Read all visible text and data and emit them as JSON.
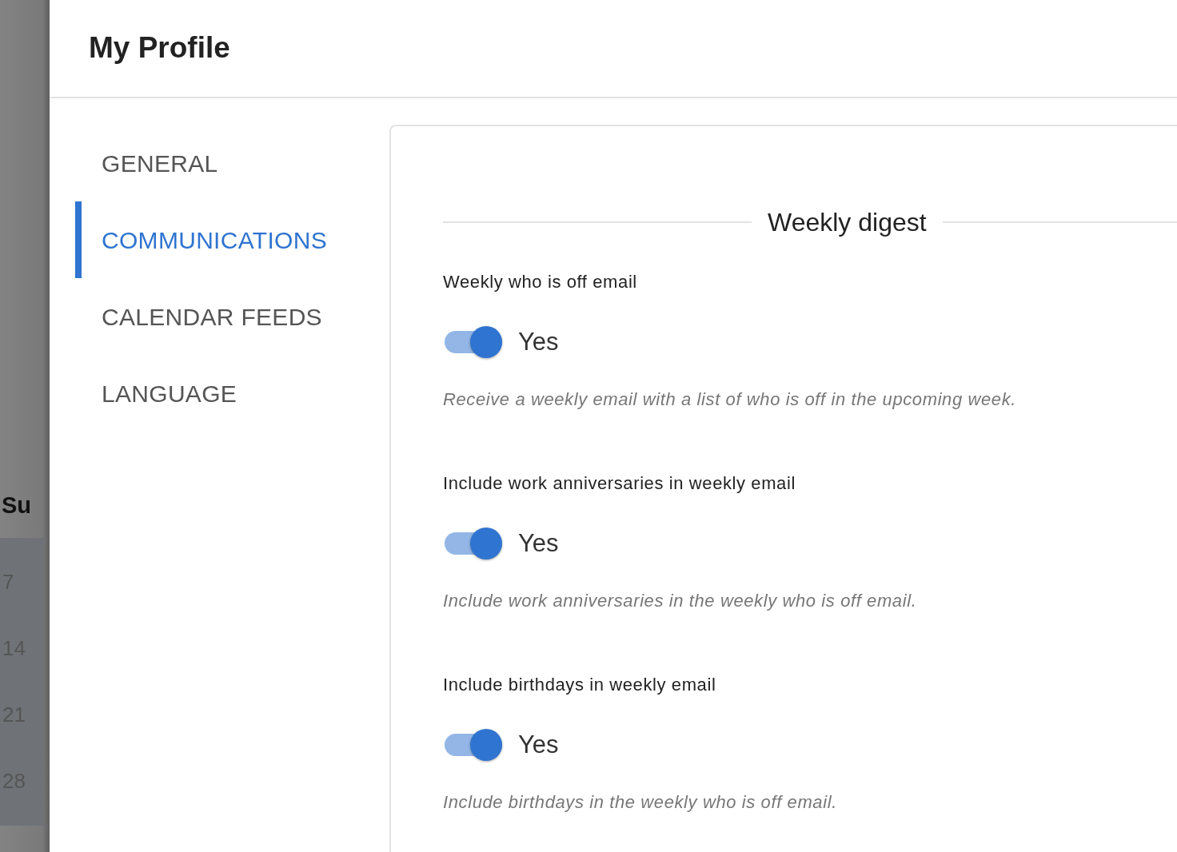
{
  "backdrop": {
    "weekday": "Su",
    "dates": [
      "7",
      "14",
      "21",
      "28"
    ]
  },
  "header": {
    "title": "My Profile"
  },
  "nav": [
    {
      "label": "GENERAL",
      "selected": false
    },
    {
      "label": "COMMUNICATIONS",
      "selected": true
    },
    {
      "label": "CALENDAR FEEDS",
      "selected": false
    },
    {
      "label": "LANGUAGE",
      "selected": false
    }
  ],
  "section": {
    "title": "Weekly digest"
  },
  "settings": [
    {
      "label": "Weekly who is off email",
      "on": true,
      "value_label": "Yes",
      "description": "Receive a weekly email with a list of who is off in the upcoming week."
    },
    {
      "label": "Include work anniversaries in weekly email",
      "on": true,
      "value_label": "Yes",
      "description": "Include work anniversaries in the weekly who is off email."
    },
    {
      "label": "Include birthdays in weekly email",
      "on": true,
      "value_label": "Yes",
      "description": "Include birthdays in the weekly who is off email."
    }
  ]
}
